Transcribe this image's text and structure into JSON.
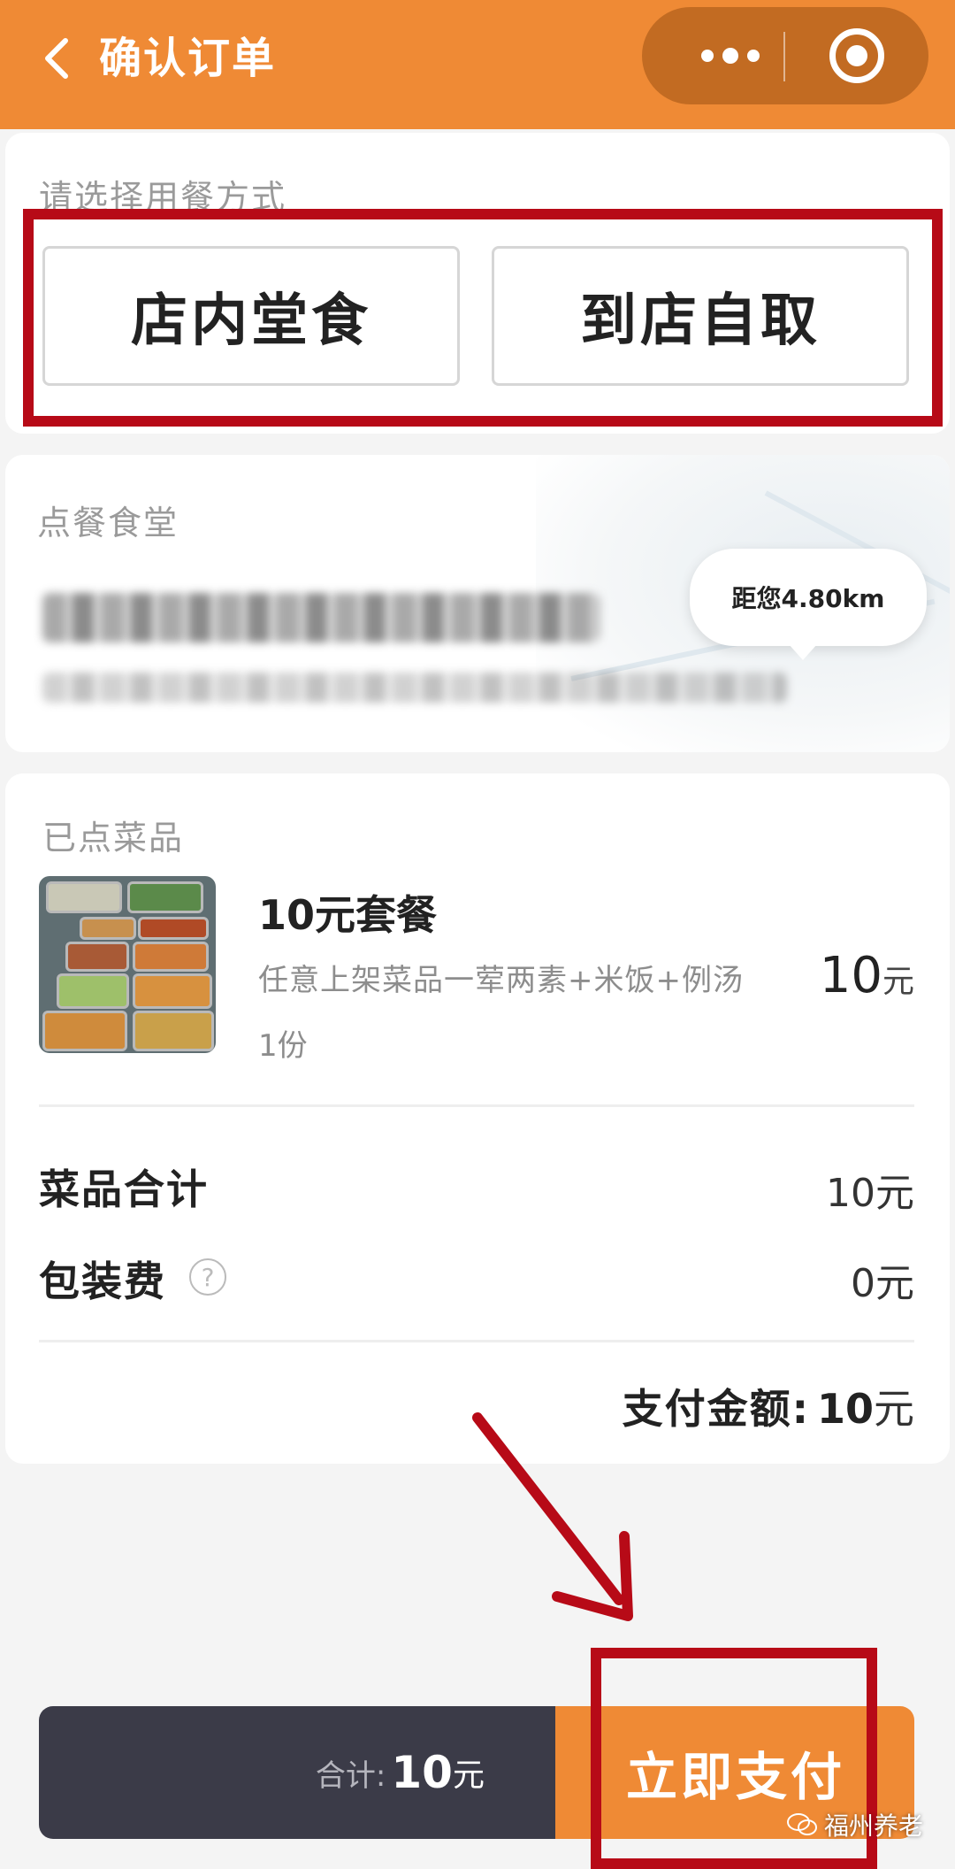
{
  "header": {
    "title": "确认订单"
  },
  "dining": {
    "label": "请选择用餐方式",
    "options": [
      "店内堂食",
      "到店自取"
    ]
  },
  "canteen": {
    "label": "点餐食堂",
    "distance": "距您4.80km"
  },
  "order": {
    "label": "已点菜品",
    "item": {
      "name": "10元套餐",
      "description": "任意上架菜品一荤两素+米饭+例汤",
      "quantity": "1份",
      "price_number": "10",
      "price_unit": "元"
    },
    "subtotal_label": "菜品合计",
    "subtotal_value": "10元",
    "packing_label": "包装费",
    "packing_help": "?",
    "packing_value": "0元",
    "pay_label": "支付金额:",
    "pay_number": "10",
    "pay_unit": "元"
  },
  "footer": {
    "total_label": "合计:",
    "total_number": "10",
    "total_unit": "元",
    "pay_button": "立即支付"
  },
  "watermark": "福州养老",
  "colors": {
    "accent": "#ef8a35",
    "annotation_red": "#b70a17",
    "bottom_bar_dark": "#3b3b48"
  }
}
